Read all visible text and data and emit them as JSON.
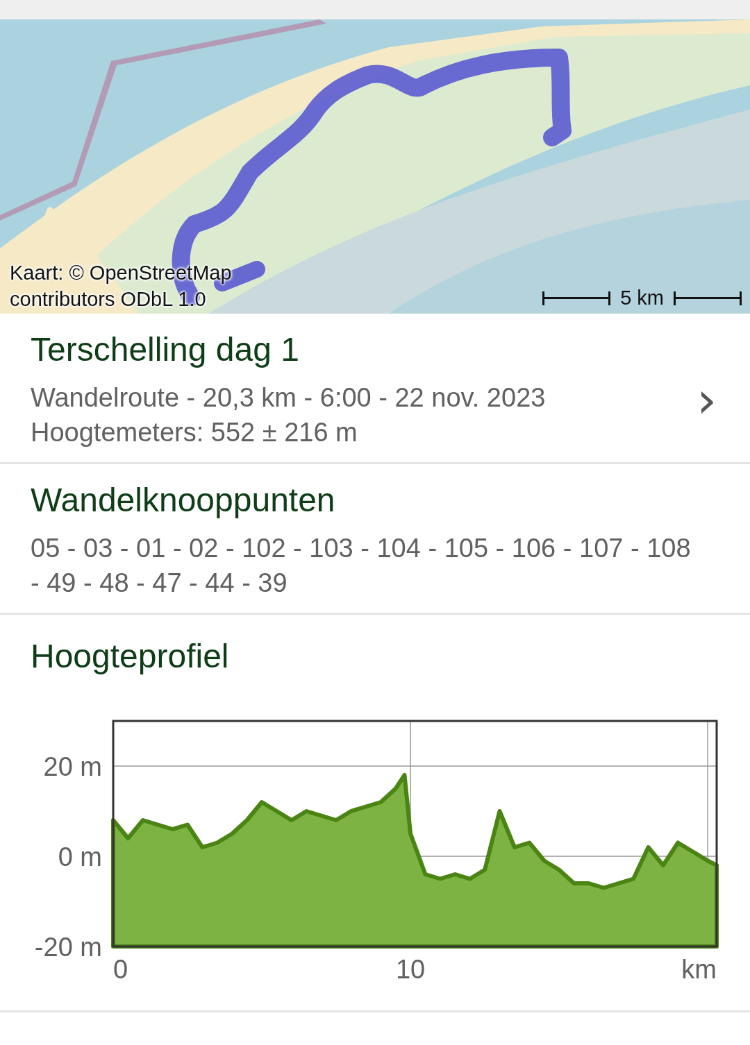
{
  "map": {
    "kind": "picture",
    "attribution": "Kaart: © OpenStreetMap contributors ODbL 1.0",
    "scale": "5 km"
  },
  "route": {
    "title": "Terschelling dag 1",
    "details": "Wandelroute - 20,3 km - 6:00 - 22 nov. 2023",
    "elevation": "Hoogtemeters: 552 ± 216 m",
    "chevron": "›"
  },
  "nodes": {
    "title": "Wandelknooppunten",
    "list": "05 - 03 - 01 - 02 - 102 - 103 - 104 - 105 - 106 - 107 - 108 - 49 - 48 - 47 - 44 - 39"
  },
  "profile": {
    "title": "Hoogteprofiel",
    "chart_data": {
      "type": "area",
      "x": [
        0,
        0.5,
        1,
        1.5,
        2,
        2.5,
        3,
        3.5,
        4,
        4.5,
        5,
        5.5,
        6,
        6.5,
        7,
        7.5,
        8,
        8.5,
        9,
        9.5,
        9.8,
        10,
        10.5,
        11,
        11.5,
        12,
        12.5,
        13,
        13.5,
        14,
        14.5,
        15,
        15.5,
        16,
        16.5,
        17,
        17.5,
        18,
        18.5,
        19,
        19.5,
        20,
        20.3
      ],
      "grid": true,
      "series": [
        {
          "color": "#7cb342",
          "values": [
            8,
            4,
            8,
            7,
            6,
            7,
            2,
            3,
            5,
            8,
            12,
            10,
            8,
            10,
            9,
            8,
            10,
            11,
            12,
            15,
            18,
            5,
            -4,
            -5,
            -4,
            -5,
            -3,
            10,
            2,
            3,
            -1,
            -3,
            -6,
            -6,
            -7,
            -6,
            -5,
            2,
            -2,
            3,
            1,
            -1,
            -2
          ]
        }
      ],
      "xlim": [
        0,
        20.3
      ],
      "ylim": [
        -20,
        30
      ],
      "xticks": [
        0,
        10,
        {
          "value": 20,
          "label": "km"
        }
      ],
      "yticks": [
        {
          "value": 20,
          "label": "20 m"
        },
        {
          "value": 0,
          "label": "0 m"
        },
        {
          "value": -20,
          "label": "-20 m"
        }
      ]
    }
  }
}
